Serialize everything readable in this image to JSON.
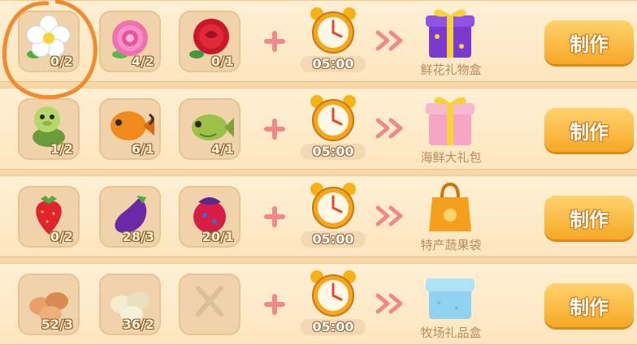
{
  "colors": {
    "accent": "#f7a826",
    "annotation": "#f28a2e",
    "row_bg": "#fff0d4"
  },
  "recipes": [
    {
      "ingredients": [
        {
          "icon": "white-flower-icon",
          "count": "0/2"
        },
        {
          "icon": "pink-flower-icon",
          "count": "4/2"
        },
        {
          "icon": "red-rose-icon",
          "count": "0/1"
        }
      ],
      "time": "05:00",
      "product_icon": "purple-gift-box-icon",
      "product_name": "鲜花礼物盒",
      "button": "制作"
    },
    {
      "ingredients": [
        {
          "icon": "turtle-icon",
          "count": "1/2"
        },
        {
          "icon": "orange-fish-icon",
          "count": "6/1"
        },
        {
          "icon": "green-fish-icon",
          "count": "4/1"
        }
      ],
      "time": "05:00",
      "product_icon": "pink-gift-box-icon",
      "product_name": "海鲜大礼包",
      "button": "制作"
    },
    {
      "ingredients": [
        {
          "icon": "strawberry-icon",
          "count": "0/2"
        },
        {
          "icon": "eggplant-icon",
          "count": "28/3"
        },
        {
          "icon": "berry-icon",
          "count": "20/1"
        }
      ],
      "time": "05:00",
      "product_icon": "orange-bag-icon",
      "product_name": "特产蔬果袋",
      "button": "制作"
    },
    {
      "ingredients": [
        {
          "icon": "brown-eggs-icon",
          "count": "52/3"
        },
        {
          "icon": "white-eggs-icon",
          "count": "36/2"
        },
        {
          "icon": "empty-slot-x-icon",
          "count": ""
        }
      ],
      "time": "05:00",
      "product_icon": "blue-gift-box-icon",
      "product_name": "牧场礼品盒",
      "button": "制作"
    }
  ]
}
